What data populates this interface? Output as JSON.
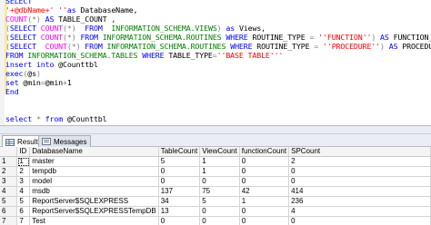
{
  "editor": {
    "lines": [
      [
        [
          "kw",
          "SELECT"
        ]
      ],
      [
        [
          "str",
          "'+@dbName+'"
        ],
        [
          "pl",
          " "
        ],
        [
          "str",
          "''"
        ],
        [
          "kw",
          "as"
        ],
        [
          "pl",
          " DatabaseName,"
        ]
      ],
      [
        [
          "fn",
          "COUNT"
        ],
        [
          "op",
          "(*)"
        ],
        [
          "pl",
          " "
        ],
        [
          "kw",
          "AS"
        ],
        [
          "pl",
          " TABLE_COUNT ,"
        ]
      ],
      [
        [
          "op",
          "("
        ],
        [
          "kw",
          "SELECT"
        ],
        [
          "pl",
          " "
        ],
        [
          "fn",
          "COUNT"
        ],
        [
          "op",
          "(*)"
        ],
        [
          "pl",
          "  "
        ],
        [
          "kw",
          "FROM"
        ],
        [
          "pl",
          "  "
        ],
        [
          "sys",
          "INFORMATION_SCHEMA.VIEWS"
        ],
        [
          "op",
          ")"
        ],
        [
          "pl",
          " "
        ],
        [
          "kw",
          "as"
        ],
        [
          "pl",
          " Views,"
        ]
      ],
      [
        [
          "op",
          "("
        ],
        [
          "kw",
          "SELECT"
        ],
        [
          "pl",
          " "
        ],
        [
          "fn",
          "COUNT"
        ],
        [
          "op",
          "(*)"
        ],
        [
          "pl",
          " "
        ],
        [
          "kw",
          "FROM"
        ],
        [
          "pl",
          " "
        ],
        [
          "sys",
          "INFORMATION_SCHEMA.ROUTINES"
        ],
        [
          "pl",
          " "
        ],
        [
          "kw",
          "WHERE"
        ],
        [
          "pl",
          " ROUTINE_TYPE "
        ],
        [
          "op",
          "="
        ],
        [
          "pl",
          " "
        ],
        [
          "str",
          "''FUNCTION''"
        ],
        [
          "op",
          ")"
        ],
        [
          "pl",
          " "
        ],
        [
          "kw",
          "AS"
        ],
        [
          "pl",
          " FUNCTION_COUNT,"
        ]
      ],
      [
        [
          "op",
          "("
        ],
        [
          "kw",
          "SELECT"
        ],
        [
          "pl",
          "  "
        ],
        [
          "fn",
          "COUNT"
        ],
        [
          "op",
          "(*)"
        ],
        [
          "pl",
          " "
        ],
        [
          "kw",
          "FROM"
        ],
        [
          "pl",
          " "
        ],
        [
          "sys",
          "INFORMATION_SCHEMA.ROUTINES"
        ],
        [
          "pl",
          " "
        ],
        [
          "kw",
          "WHERE"
        ],
        [
          "pl",
          " ROUTINE_TYPE "
        ],
        [
          "op",
          "="
        ],
        [
          "pl",
          " "
        ],
        [
          "str",
          "''PROCEDURE''"
        ],
        [
          "op",
          ")"
        ],
        [
          "pl",
          " "
        ],
        [
          "kw",
          "AS"
        ],
        [
          "pl",
          " PROCEDURE_COUNT"
        ]
      ],
      [
        [
          "kw",
          "FROM"
        ],
        [
          "pl",
          " "
        ],
        [
          "sys",
          "INFORMATION_SCHEMA.TABLES"
        ],
        [
          "pl",
          " "
        ],
        [
          "kw",
          "WHERE"
        ],
        [
          "pl",
          " TABLE_TYPE"
        ],
        [
          "op",
          "="
        ],
        [
          "str",
          "''BASE TABLE'''"
        ]
      ],
      [
        [
          "kw",
          "insert into"
        ],
        [
          "pl",
          " @Counttbl"
        ]
      ],
      [
        [
          "kw",
          "exec"
        ],
        [
          "op",
          "("
        ],
        [
          "var",
          "@s"
        ],
        [
          "op",
          ")"
        ]
      ],
      [
        [
          "kw",
          "set"
        ],
        [
          "pl",
          " @min"
        ],
        [
          "op",
          "="
        ],
        [
          "pl",
          "@min"
        ],
        [
          "op",
          "+"
        ],
        [
          "pl",
          "1"
        ]
      ],
      [
        [
          "kw",
          "End"
        ]
      ],
      [],
      [],
      [
        [
          "kw",
          "select"
        ],
        [
          "pl",
          " "
        ],
        [
          "op",
          "*"
        ],
        [
          "pl",
          " "
        ],
        [
          "kw",
          "from"
        ],
        [
          "pl",
          " @Counttbl"
        ]
      ]
    ]
  },
  "tabs": [
    {
      "label": "Results",
      "icon": "grid-results-icon",
      "active": true
    },
    {
      "label": "Messages",
      "icon": "messages-icon",
      "active": false
    }
  ],
  "grid": {
    "columns": [
      "ID",
      "DatabaseName",
      "TableCount",
      "ViewCount",
      "functionCount",
      "SPCount"
    ],
    "rows": [
      [
        "1",
        "1",
        "master",
        "5",
        "1",
        "0",
        "2"
      ],
      [
        "2",
        "2",
        "tempdb",
        "0",
        "1",
        "0",
        "0"
      ],
      [
        "3",
        "3",
        "model",
        "0",
        "0",
        "0",
        "0"
      ],
      [
        "4",
        "4",
        "msdb",
        "137",
        "75",
        "42",
        "414"
      ],
      [
        "5",
        "5",
        "ReportServer$SQLEXPRESS",
        "34",
        "5",
        "1",
        "236"
      ],
      [
        "6",
        "6",
        "ReportServer$SQLEXPRESSTempDB",
        "13",
        "0",
        "0",
        "4"
      ],
      [
        "7",
        "7",
        "Test",
        "0",
        "0",
        "0",
        "0"
      ]
    ]
  },
  "colors": {
    "keyword": "#0000ff",
    "string": "#ff0000",
    "function": "#ff00ff",
    "system_object": "#008000",
    "operator": "#808080"
  }
}
